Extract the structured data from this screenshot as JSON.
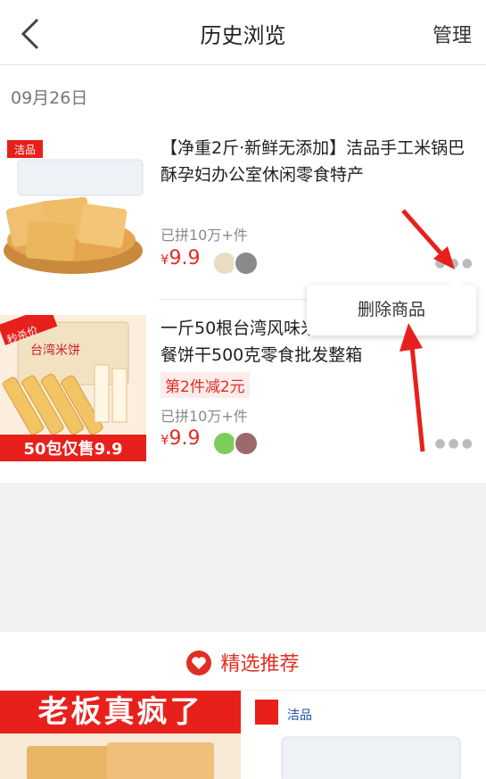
{
  "header": {
    "title": "历史浏览",
    "manage_label": "管理"
  },
  "history": {
    "date": "09月26日",
    "items": [
      {
        "title": "【净重2斤·新鲜无添加】洁品手工米锅巴酥孕妇办公室休闲零食特产",
        "sold": "已拼10万+件",
        "price_symbol": "¥",
        "price": "9.9",
        "image_brand": "洁品"
      },
      {
        "title": "一斤50根台湾风味米饼能量棒儿童营养早餐饼干500克零食批发整箱",
        "promo": "第2件减2元",
        "sold": "已拼10万+件",
        "price_symbol": "¥",
        "price": "9.9",
        "image_tag": "秒杀价",
        "image_text": "台湾米饼",
        "image_banner": "50包仅售9.9"
      }
    ]
  },
  "popup": {
    "delete_label": "删除商品"
  },
  "recommend": {
    "label": "精选推荐",
    "cards": [
      {
        "banner": "老板真疯了"
      },
      {
        "brand": "洁品"
      }
    ]
  },
  "colors": {
    "accent": "#e02e24",
    "background": "#f2f2f2"
  },
  "icons": [
    "back-chevron-icon",
    "more-dots-icon",
    "heart-icon",
    "red-arrow"
  ]
}
